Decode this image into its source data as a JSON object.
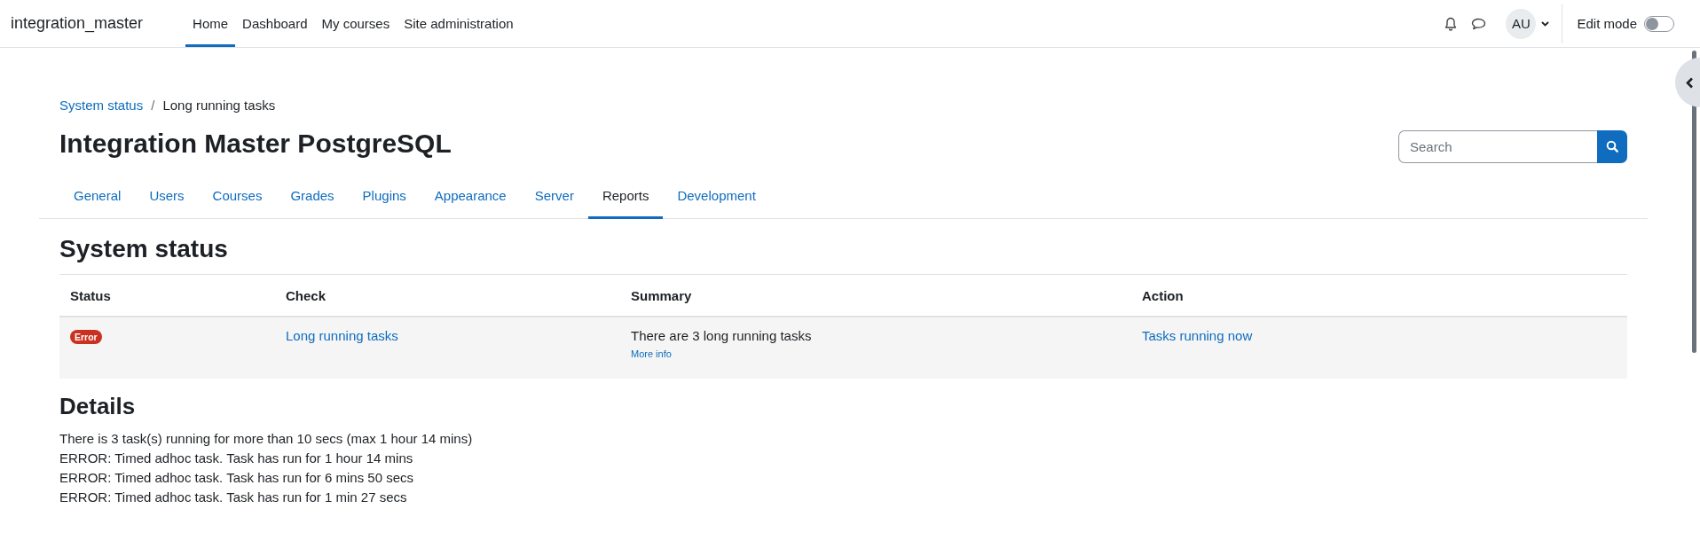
{
  "site_name": "integration_master",
  "nav": [
    {
      "label": "Home",
      "selected": true
    },
    {
      "label": "Dashboard",
      "selected": false
    },
    {
      "label": "My courses",
      "selected": false
    },
    {
      "label": "Site administration",
      "selected": false
    }
  ],
  "user": {
    "initials": "AU"
  },
  "edit_mode": {
    "label": "Edit mode",
    "on": false
  },
  "breadcrumb": [
    {
      "label": "System status",
      "kind": "link"
    },
    {
      "label": "/",
      "kind": "separator"
    },
    {
      "label": "Long running tasks",
      "kind": "current"
    }
  ],
  "page_title": "Integration Master PostgreSQL",
  "search": {
    "placeholder": "Search"
  },
  "tabs": [
    {
      "label": "General",
      "selected": false
    },
    {
      "label": "Users",
      "selected": false
    },
    {
      "label": "Courses",
      "selected": false
    },
    {
      "label": "Grades",
      "selected": false
    },
    {
      "label": "Plugins",
      "selected": false
    },
    {
      "label": "Appearance",
      "selected": false
    },
    {
      "label": "Server",
      "selected": false
    },
    {
      "label": "Reports",
      "selected": true
    },
    {
      "label": "Development",
      "selected": false
    }
  ],
  "section_title": "System status",
  "table": {
    "columns": [
      "Status",
      "Check",
      "Summary",
      "Action"
    ],
    "rows": [
      {
        "status": "Error",
        "check": "Long running tasks",
        "summary": "There are 3 long running tasks",
        "more_info": "More info",
        "action": "Tasks running now"
      }
    ]
  },
  "details": {
    "title": "Details",
    "lines": [
      "There is 3 task(s) running for more than 10 secs (max 1 hour 14 mins)",
      "ERROR: Timed adhoc task. Task has run for 1 hour 14 mins",
      "ERROR: Timed adhoc task. Task has run for 6 mins 50 secs",
      "ERROR: Timed adhoc task. Task has run for 1 min 27 secs"
    ]
  }
}
